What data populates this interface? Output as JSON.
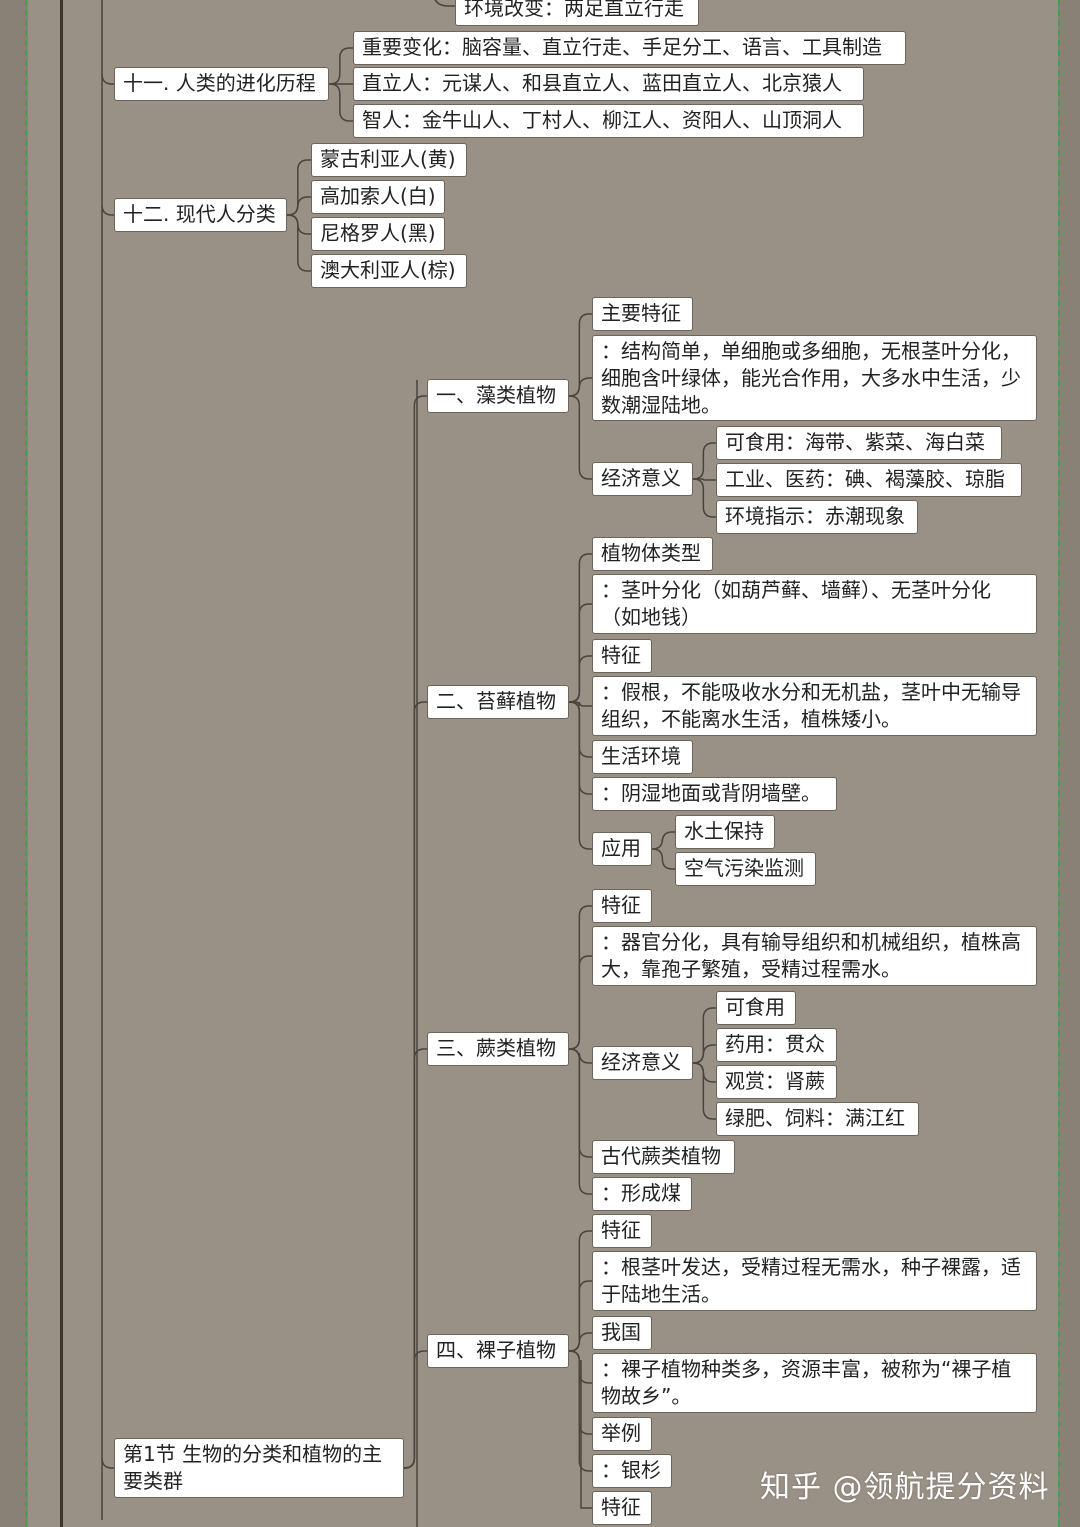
{
  "mindmap": {
    "nodes": [
      {
        "id": "n_top_hidden",
        "text": "环境改变：两足直立行走"
      },
      {
        "id": "n11",
        "text": "十一. 人类的进化历程"
      },
      {
        "id": "n11a",
        "text": "重要变化：脑容量、直立行走、手足分工、语言、工具制造"
      },
      {
        "id": "n11b",
        "text": "直立人：元谋人、和县直立人、蓝田直立人、北京猿人"
      },
      {
        "id": "n11c",
        "text": "智人：金牛山人、丁村人、柳江人、资阳人、山顶洞人"
      },
      {
        "id": "n12",
        "text": "十二. 现代人分类"
      },
      {
        "id": "n12a",
        "text": "蒙古利亚人(黄)"
      },
      {
        "id": "n12b",
        "text": "高加索人(白)"
      },
      {
        "id": "n12c",
        "text": "尼格罗人(黑)"
      },
      {
        "id": "n12d",
        "text": "澳大利亚人(棕)"
      },
      {
        "id": "sec1",
        "text": "第1节 生物的分类和植物的主要类群"
      },
      {
        "id": "p1",
        "text": "一、藻类植物"
      },
      {
        "id": "p1a",
        "text": "主要特征"
      },
      {
        "id": "p1b",
        "text": "：结构简单，单细胞或多细胞，无根茎叶分化，细胞含叶绿体，能光合作用，大多水中生活，少数潮湿陆地。"
      },
      {
        "id": "p1c",
        "text": "经济意义"
      },
      {
        "id": "p1c1",
        "text": "可食用：海带、紫菜、海白菜"
      },
      {
        "id": "p1c2",
        "text": "工业、医药：碘、褐藻胶、琼脂"
      },
      {
        "id": "p1c3",
        "text": "环境指示：赤潮现象"
      },
      {
        "id": "p2",
        "text": "二、苔藓植物"
      },
      {
        "id": "p2a",
        "text": "植物体类型"
      },
      {
        "id": "p2b",
        "text": "：茎叶分化（如葫芦藓、墙藓）、无茎叶分化（如地钱）"
      },
      {
        "id": "p2c",
        "text": "特征"
      },
      {
        "id": "p2d",
        "text": "：假根，不能吸收水分和无机盐，茎叶中无输导组织，不能离水生活，植株矮小。"
      },
      {
        "id": "p2e",
        "text": "生活环境"
      },
      {
        "id": "p2f",
        "text": "：阴湿地面或背阴墙壁。"
      },
      {
        "id": "p2g",
        "text": "应用"
      },
      {
        "id": "p2g1",
        "text": "水土保持"
      },
      {
        "id": "p2g2",
        "text": "空气污染监测"
      },
      {
        "id": "p3",
        "text": "三、蕨类植物"
      },
      {
        "id": "p3a",
        "text": "特征"
      },
      {
        "id": "p3b",
        "text": "：器官分化，具有输导组织和机械组织，植株高大，靠孢子繁殖，受精过程需水。"
      },
      {
        "id": "p3c",
        "text": "经济意义"
      },
      {
        "id": "p3c1",
        "text": "可食用"
      },
      {
        "id": "p3c2",
        "text": "药用：贯众"
      },
      {
        "id": "p3c3",
        "text": "观赏：肾蕨"
      },
      {
        "id": "p3c4",
        "text": "绿肥、饲料：满江红"
      },
      {
        "id": "p3d",
        "text": "古代蕨类植物"
      },
      {
        "id": "p3e",
        "text": "：形成煤"
      },
      {
        "id": "p4",
        "text": "四、裸子植物"
      },
      {
        "id": "p4a",
        "text": "特征"
      },
      {
        "id": "p4b",
        "text": "：根茎叶发达，受精过程无需水，种子裸露，适于陆地生活。"
      },
      {
        "id": "p4c",
        "text": "我国"
      },
      {
        "id": "p4d",
        "text": "：裸子植物种类多，资源丰富，被称为“裸子植物故乡”。"
      },
      {
        "id": "p4e",
        "text": "举例"
      },
      {
        "id": "p4f",
        "text": "：银杉"
      },
      {
        "id": "p5a",
        "text": "特征"
      }
    ],
    "edges": [
      [
        "n11",
        "n11a"
      ],
      [
        "n11",
        "n11b"
      ],
      [
        "n11",
        "n11c"
      ],
      [
        "n12",
        "n12a"
      ],
      [
        "n12",
        "n12b"
      ],
      [
        "n12",
        "n12c"
      ],
      [
        "n12",
        "n12d"
      ],
      [
        "p1",
        "p1a"
      ],
      [
        "p1",
        "p1b"
      ],
      [
        "p1",
        "p1c"
      ],
      [
        "p1c",
        "p1c1"
      ],
      [
        "p1c",
        "p1c2"
      ],
      [
        "p1c",
        "p1c3"
      ],
      [
        "p2",
        "p2a"
      ],
      [
        "p2",
        "p2b"
      ],
      [
        "p2",
        "p2c"
      ],
      [
        "p2",
        "p2d"
      ],
      [
        "p2",
        "p2e"
      ],
      [
        "p2",
        "p2f"
      ],
      [
        "p2",
        "p2g"
      ],
      [
        "p2g",
        "p2g1"
      ],
      [
        "p2g",
        "p2g2"
      ],
      [
        "p3",
        "p3a"
      ],
      [
        "p3",
        "p3b"
      ],
      [
        "p3",
        "p3c"
      ],
      [
        "p3",
        "p3d"
      ],
      [
        "p3",
        "p3e"
      ],
      [
        "p3c",
        "p3c1"
      ],
      [
        "p3c",
        "p3c2"
      ],
      [
        "p3c",
        "p3c3"
      ],
      [
        "p3c",
        "p3c4"
      ],
      [
        "p4",
        "p4a"
      ],
      [
        "p4",
        "p4b"
      ],
      [
        "p4",
        "p4c"
      ],
      [
        "p4",
        "p4d"
      ],
      [
        "p4",
        "p4e"
      ],
      [
        "p4",
        "p4f"
      ],
      [
        "sec1",
        "p1"
      ],
      [
        "sec1",
        "p2"
      ],
      [
        "sec1",
        "p3"
      ],
      [
        "sec1",
        "p4"
      ]
    ]
  },
  "watermark": "知乎 @领航提分资料",
  "colors": {
    "background": "#9a9186",
    "node_fill": "#ffffff",
    "node_border": "#6d655c",
    "link": "#4a443e",
    "frame_line": "#3fa34d"
  }
}
